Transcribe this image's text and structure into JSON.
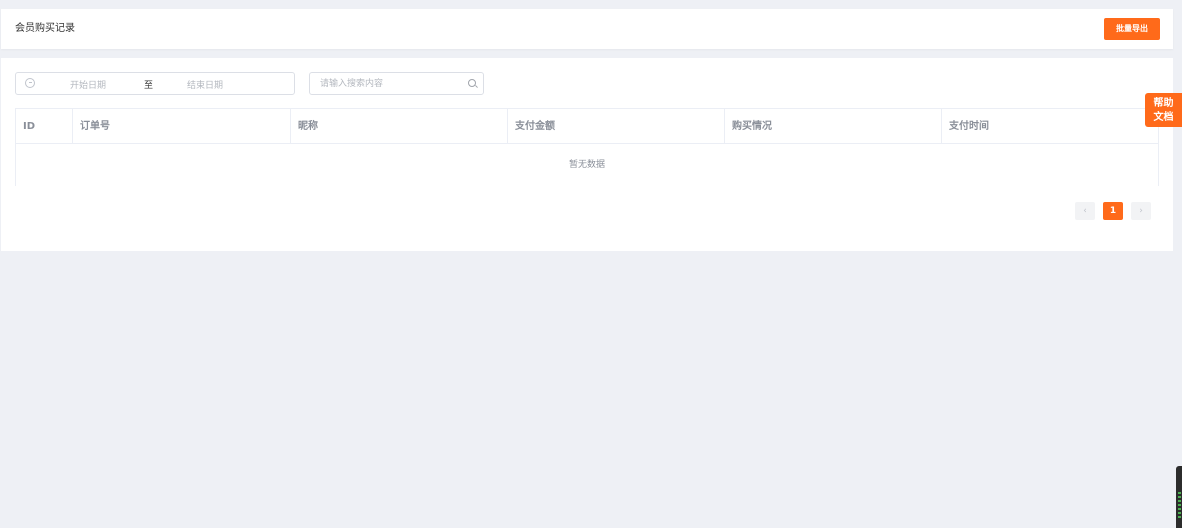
{
  "header": {
    "title": "会员购买记录",
    "export_label": "批量导出"
  },
  "filters": {
    "start_placeholder": "开始日期",
    "range_separator": "至",
    "end_placeholder": "结束日期",
    "search_placeholder": "请输入搜索内容"
  },
  "table": {
    "columns": [
      "ID",
      "订单号",
      "昵称",
      "支付金额",
      "购买情况",
      "支付时间"
    ],
    "empty_text": "暂无数据"
  },
  "pagination": {
    "prev": "‹",
    "current": "1",
    "next": "›"
  },
  "help": {
    "line1": "帮助",
    "line2": "文档"
  },
  "colors": {
    "accent": "#ff6a1a",
    "page_bg": "#eef0f5"
  }
}
